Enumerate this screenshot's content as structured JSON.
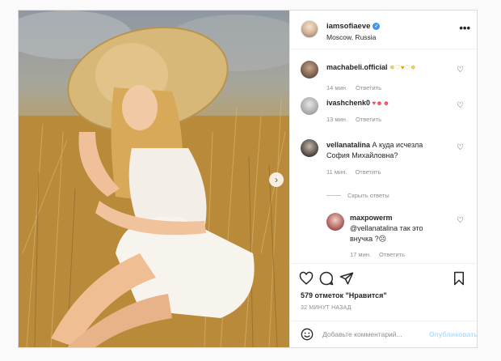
{
  "post": {
    "author": "iamsofiaeve",
    "location": "Moscow, Russia",
    "more_icon": "ellipsis-icon",
    "likes": "579 отметок \"Нравится\"",
    "time_ago": "32 МИНУТ НАЗАД",
    "add_comment_placeholder": "Добавьте комментарий...",
    "publish_label": "Опубликовать"
  },
  "comments": [
    {
      "user": "machabeli.official",
      "text": "",
      "emojis": "✵♡♥♡✵",
      "time": "14 мин.",
      "reply": "Ответить"
    },
    {
      "user": "ivashchenk0",
      "text": "",
      "emojis": "♥☻☻",
      "time": "13 мин.",
      "reply": "Ответить"
    },
    {
      "user": "vellanatalina",
      "text": "А куда исчезла София Михайловна?",
      "time": "11 мин.",
      "reply": "Ответить"
    }
  ],
  "hide_replies": "Скрыть ответы",
  "reply_comment": {
    "user": "maxpowerm",
    "text": "@vellanatalina так это внучка ?☹",
    "time": "17 мин.",
    "reply": "Ответить"
  },
  "colors": {
    "accent": "#3897f0",
    "publish_disabled": "#b2dffc",
    "muted": "#8e8e8e",
    "heart_red": "#ed4956"
  }
}
